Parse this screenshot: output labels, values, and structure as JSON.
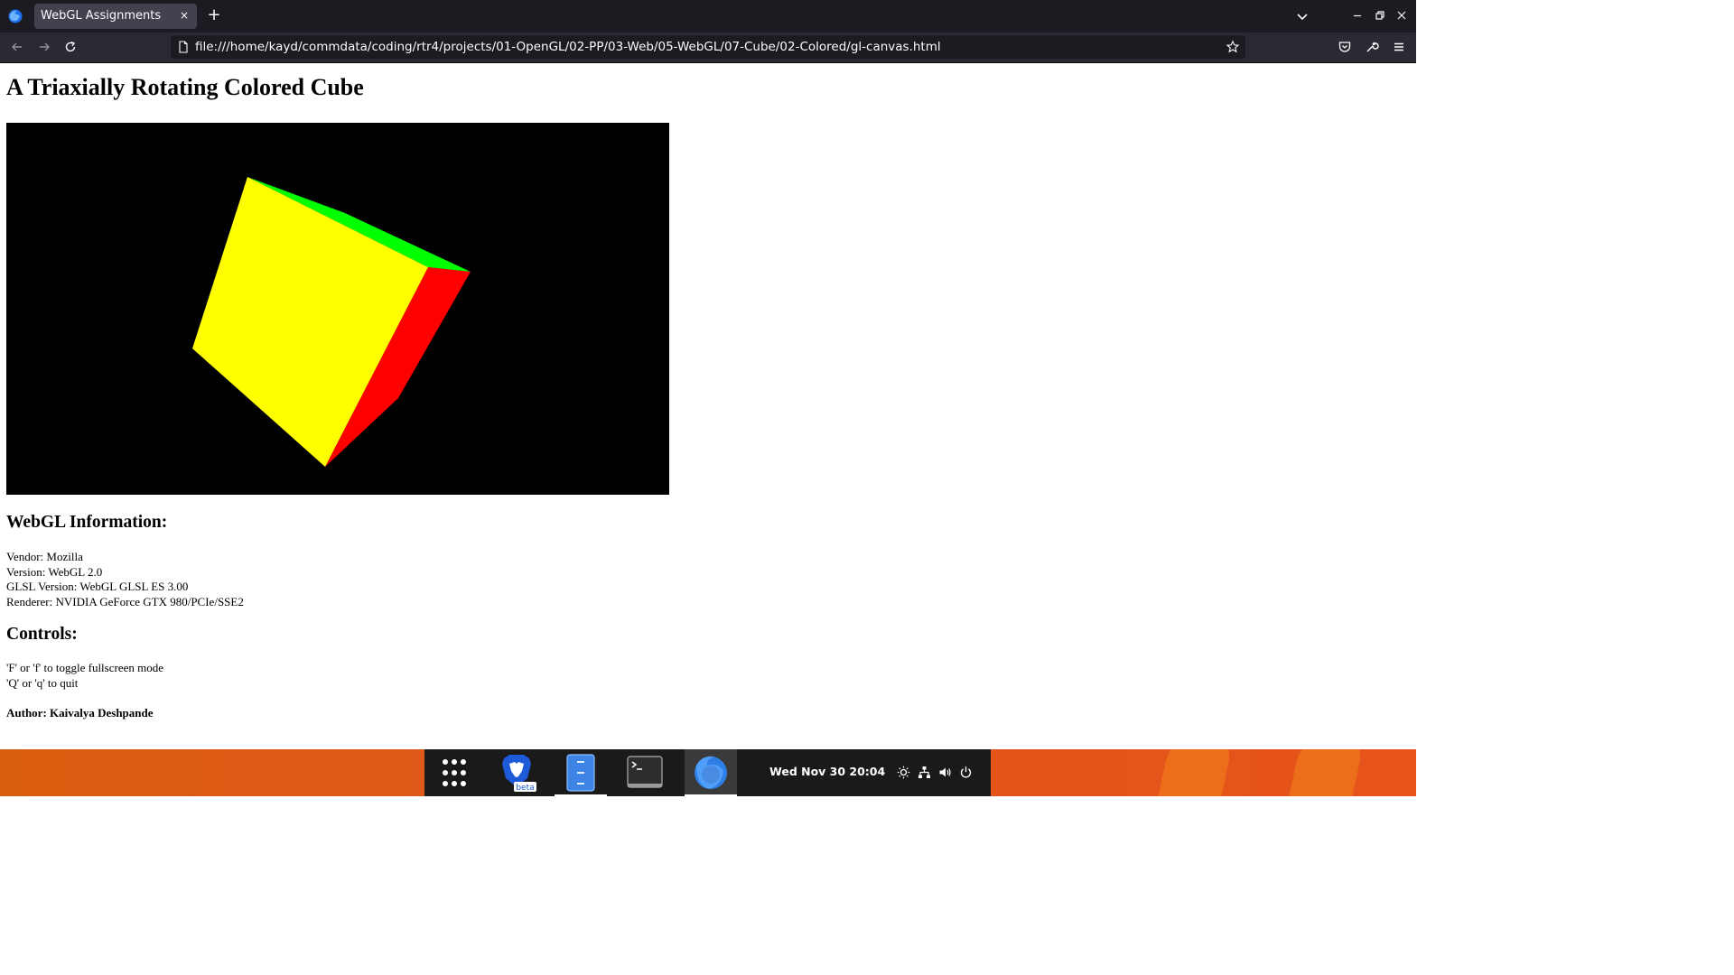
{
  "browser": {
    "tab": {
      "title": "WebGL Assignments",
      "close": "×"
    },
    "new_tab": "+",
    "url": "file:///home/kayd/commdata/coding/rtr4/projects/01-OpenGL/02-PP/03-Web/05-WebGL/07-Cube/02-Colored/gl-canvas.html"
  },
  "page": {
    "title": "A Triaxially Rotating Colored Cube",
    "webgl_info": {
      "heading": "WebGL Information:",
      "lines": [
        "Vendor: Mozilla",
        "Version: WebGL 2.0",
        "GLSL Version: WebGL GLSL ES 3.00",
        "Renderer: NVIDIA GeForce GTX 980/PCIe/SSE2"
      ]
    },
    "controls": {
      "heading": "Controls:",
      "lines": [
        "'F' or 'f' to toggle fullscreen mode",
        "'Q' or 'q' to quit"
      ]
    },
    "author": "Author: Kaivalya Deshpande",
    "cube_face_colors": {
      "front": "#ffff00",
      "top": "#00ff00",
      "right": "#ff0000"
    }
  },
  "taskbar": {
    "clock": "Wed Nov 30  20:04",
    "apps": [
      "app-grid-icon",
      "brave-beta-icon",
      "files-icon",
      "terminal-icon",
      "firefox-icon"
    ],
    "brave_badge": "beta"
  },
  "colors": {
    "tabbar_bg": "#1c1b22",
    "navbar_bg": "#2b2a33",
    "desktop_accent": "#e45419"
  }
}
